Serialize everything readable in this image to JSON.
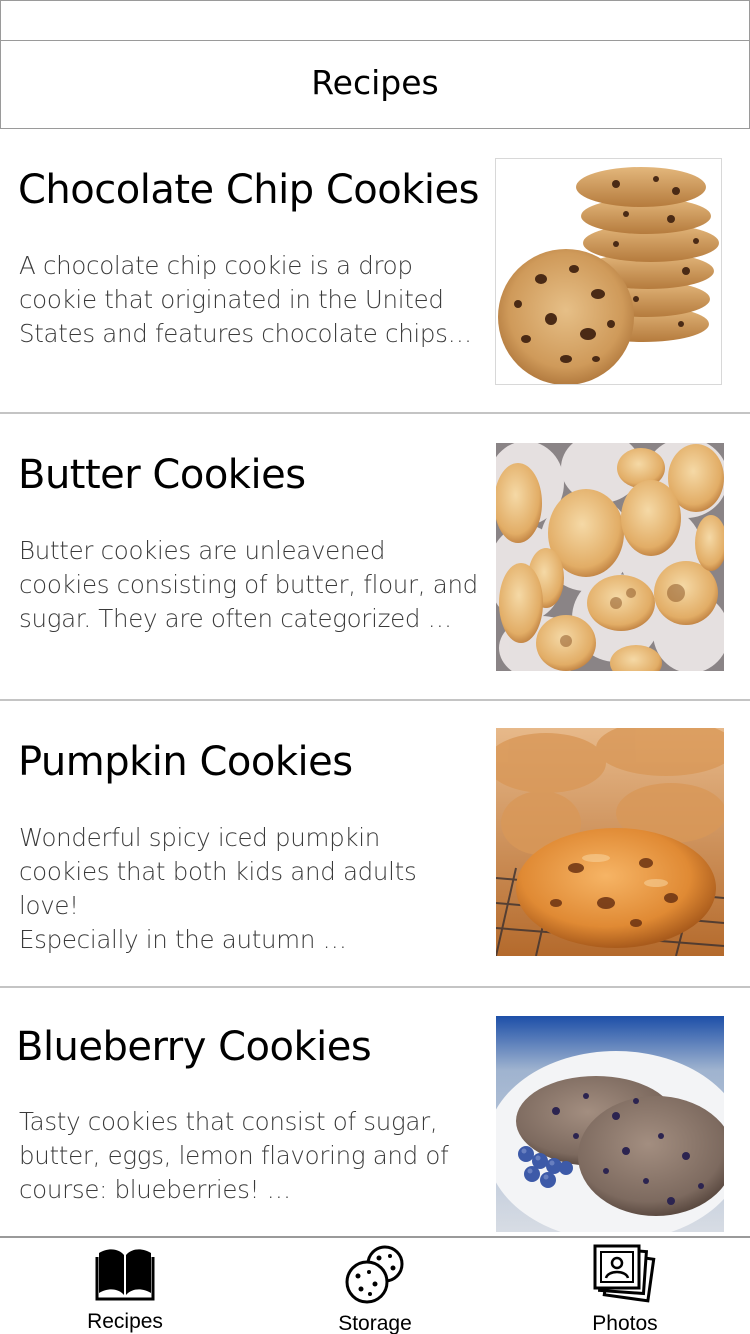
{
  "nav": {
    "title": "Recipes"
  },
  "recipes": [
    {
      "title": "Chocolate Chip Cookies",
      "desc_lines": [
        "A chocolate chip cookie is a drop",
        "cookie that originated in the United",
        "States and features chocolate chips…"
      ],
      "image": "chocolate-chip-cookie-stack"
    },
    {
      "title": "Butter Cookies",
      "desc_lines": [
        "Butter cookies are unleavened",
        "cookies consisting of butter, flour, and",
        "sugar. They are often categorized …"
      ],
      "image": "butter-cookies-tin"
    },
    {
      "title": "Pumpkin Cookies",
      "desc_lines": [
        "Wonderful spicy iced pumpkin",
        "cookies that both kids and adults love!",
        "Especially in the autumn …"
      ],
      "image": "pumpkin-cookies-rack"
    },
    {
      "title": "Blueberry Cookies",
      "desc_lines": [
        "Tasty cookies that consist of sugar,",
        "butter, eggs, lemon flavoring and of",
        "course: blueberries! …"
      ],
      "image": "blueberry-cookies-plate"
    }
  ],
  "tabs": [
    {
      "label": "Recipes",
      "icon": "book-icon"
    },
    {
      "label": "Storage",
      "icon": "cookies-icon"
    },
    {
      "label": "Photos",
      "icon": "photos-icon"
    }
  ],
  "colors": {
    "divider": "#c4c4c4",
    "border": "#9a9a9a",
    "text": "#000000",
    "desc_text": "#3a3a3a"
  }
}
